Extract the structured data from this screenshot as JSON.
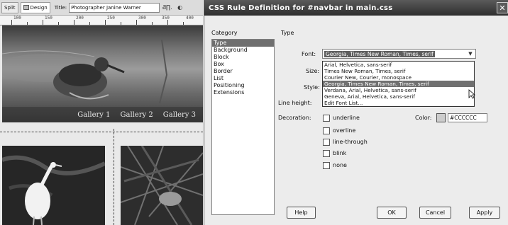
{
  "editor": {
    "toolbar": {
      "split_label": "Split",
      "design_label": "Design",
      "title_label": "Title:",
      "title_value": "Photographer Janine Warner",
      "icon_1": "Ƌ∏.",
      "icon_2": "◐"
    },
    "ruler": [
      "100",
      "150",
      "200",
      "250",
      "300",
      "350",
      "400"
    ],
    "nav": [
      "Gallery 1",
      "Gallery 2",
      "Gallery 3"
    ]
  },
  "dialog": {
    "title": "CSS Rule Definition for #navbar in main.css",
    "close": "✕",
    "category_header": "Category",
    "panel_header": "Type",
    "categories": [
      "Type",
      "Background",
      "Block",
      "Box",
      "Border",
      "List",
      "Positioning",
      "Extensions"
    ],
    "selected_category": "Type",
    "font_label": "Font:",
    "font_value": "Georgia, Times New Roman, Times, serif",
    "size_label": "Size:",
    "style_label": "Style:",
    "line_height_label": "Line height:",
    "decoration_label": "Decoration:",
    "font_options": [
      "Arial, Helvetica, sans-serif",
      "Times New Roman, Times, serif",
      "Courier New, Courier, monospace",
      "Georgia, Times New Roman, Times, serif",
      "Verdana, Arial, Helvetica, sans-serif",
      "Geneva, Arial, Helvetica, sans-serif",
      "Edit Font List..."
    ],
    "highlighted_option": "Georgia, Times New Roman, Times, serif",
    "decorations": [
      "underline",
      "overline",
      "line-through",
      "blink",
      "none"
    ],
    "color_label": "Color:",
    "color_value": "#CCCCCC",
    "buttons": {
      "help": "Help",
      "ok": "OK",
      "cancel": "Cancel",
      "apply": "Apply"
    }
  }
}
